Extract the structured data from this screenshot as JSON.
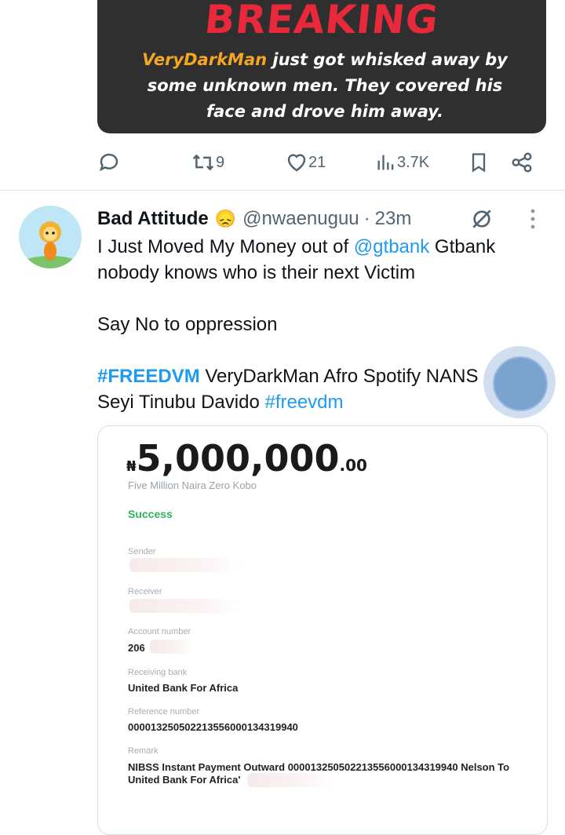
{
  "media": {
    "headline": "BREAKING",
    "highlight": "VeryDarkMan",
    "line1_rest": " just got whisked away by",
    "line2": "some unknown men. They covered his",
    "line3": "face and drove him away."
  },
  "action_bar": {
    "reposts": "9",
    "likes": "21",
    "views": "3.7K"
  },
  "tweet": {
    "author_name": "Bad Attitude",
    "emoji": "😞",
    "handle": "@nwaenuguu",
    "separator": "·",
    "time": "23m",
    "text_line1_a": "I Just Moved My Money out of ",
    "mention": "@gtbank",
    "text_line1_b": " Gtbank",
    "text_line2": "nobody knows who is their next Victim",
    "text_para2": "Say No to oppression",
    "hashtag1": "#FREEDVM",
    "text_para3_mid": " VeryDarkMan Afro Spotify NANS",
    "text_para3_line2": "Seyi Tinubu Davido ",
    "hashtag2": "#freevdm"
  },
  "receipt": {
    "currency": "₦",
    "amount": "5,000,000",
    "decimal": ".00",
    "amount_words": "Five Million  Naira Zero Kobo",
    "status": "Success",
    "sender_label": "Sender",
    "receiver_label": "Receiver",
    "account_label": "Account number",
    "account_value": "206",
    "bank_label": "Receiving bank",
    "bank_value": "United Bank For Africa",
    "reference_label": "Reference number",
    "reference_value": "000013250502213556000134319940",
    "remark_label": "Remark",
    "remark_line1": "NIBSS Instant Payment Outward 000013250502213556000134319940 Nelson To",
    "remark_line2": "United Bank For Africa'"
  },
  "colors": {
    "accent": "#1d9bf0",
    "breaking_red": "#e8293b",
    "success_green": "#2fb45a"
  }
}
